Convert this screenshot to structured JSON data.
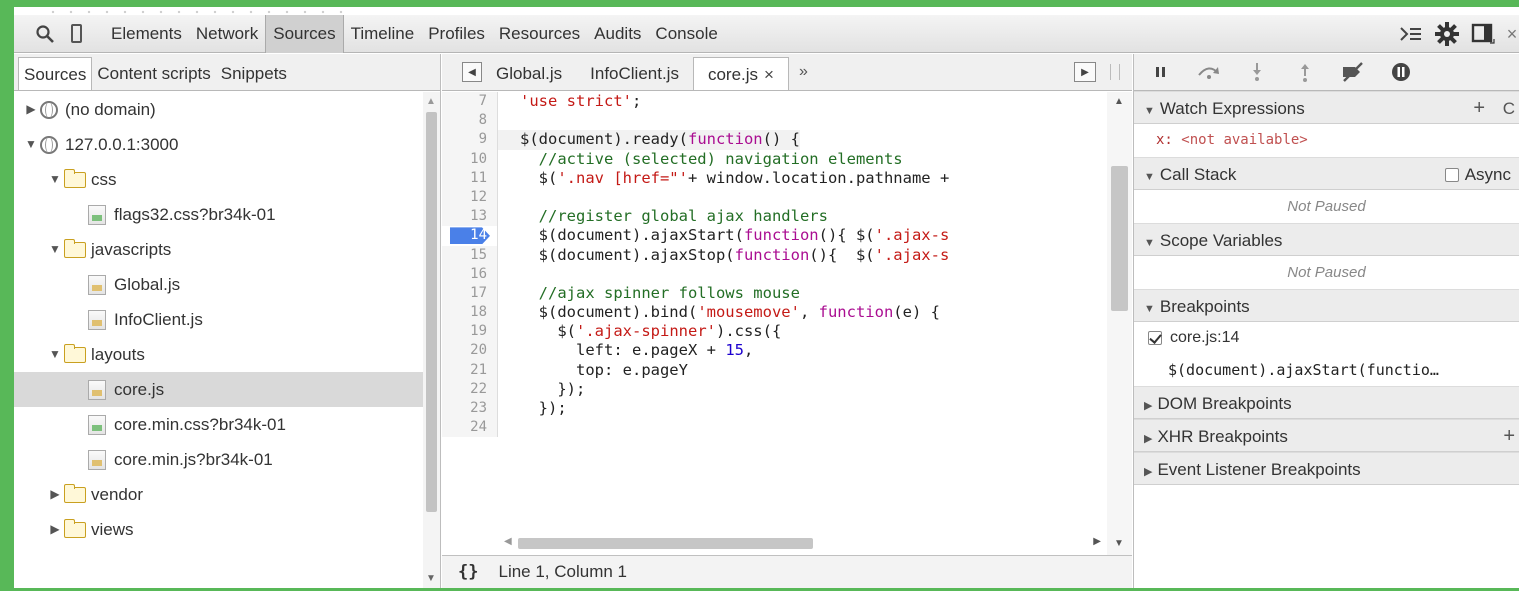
{
  "toolbar": {
    "tabs": [
      "Elements",
      "Network",
      "Sources",
      "Timeline",
      "Profiles",
      "Resources",
      "Audits",
      "Console"
    ],
    "active_tab": "Sources"
  },
  "navigator": {
    "tabs": [
      "Sources",
      "Content scripts",
      "Snippets"
    ],
    "tree": [
      {
        "label": "(no domain)",
        "kind": "domain",
        "depth": 0,
        "expanded": false
      },
      {
        "label": "127.0.0.1:3000",
        "kind": "domain",
        "depth": 0,
        "expanded": true
      },
      {
        "label": "css",
        "kind": "folder",
        "depth": 1,
        "expanded": true
      },
      {
        "label": "flags32.css?br34k-01",
        "kind": "css",
        "depth": 2
      },
      {
        "label": "javascripts",
        "kind": "folder",
        "depth": 1,
        "expanded": true
      },
      {
        "label": "Global.js",
        "kind": "js",
        "depth": 2
      },
      {
        "label": "InfoClient.js",
        "kind": "js",
        "depth": 2
      },
      {
        "label": "layouts",
        "kind": "folder",
        "depth": 1,
        "expanded": true
      },
      {
        "label": "core.js",
        "kind": "js",
        "depth": 2,
        "selected": true
      },
      {
        "label": "core.min.css?br34k-01",
        "kind": "css",
        "depth": 2
      },
      {
        "label": "core.min.js?br34k-01",
        "kind": "js",
        "depth": 2
      },
      {
        "label": "vendor",
        "kind": "folder",
        "depth": 1,
        "expanded": false
      },
      {
        "label": "views",
        "kind": "folder",
        "depth": 1,
        "expanded": false
      }
    ]
  },
  "editor": {
    "tabs": [
      {
        "label": "Global.js",
        "active": false
      },
      {
        "label": "InfoClient.js",
        "active": false
      },
      {
        "label": "core.js",
        "active": true,
        "close": "×"
      }
    ],
    "more": "»",
    "breakpoint_line": "14",
    "lines": [
      {
        "n": "7",
        "html": "<span class=\"str\">'use strict'</span>;"
      },
      {
        "n": "8",
        "html": ""
      },
      {
        "n": "9",
        "html": "$(document).ready(<span class=\"kw\">function</span>() {"
      },
      {
        "n": "10",
        "html": "  <span class=\"cm\">//active (selected) navigation elements</span>"
      },
      {
        "n": "11",
        "html": "  $(<span class=\"str\">'.nav [href=\"'</span>+ window.location.pathname +"
      },
      {
        "n": "12",
        "html": ""
      },
      {
        "n": "13",
        "html": "  <span class=\"cm\">//register global ajax handlers</span>"
      },
      {
        "n": "14",
        "html": "  $(document).ajaxStart(<span class=\"kw\">function</span>(){ $(<span class=\"str\">'.ajax-s</span>"
      },
      {
        "n": "15",
        "html": "  $(document).ajaxStop(<span class=\"kw\">function</span>(){  $(<span class=\"str\">'.ajax-s</span>"
      },
      {
        "n": "16",
        "html": ""
      },
      {
        "n": "17",
        "html": "  <span class=\"cm\">//ajax spinner follows mouse</span>"
      },
      {
        "n": "18",
        "html": "  $(document).bind(<span class=\"str\">'mousemove'</span>, <span class=\"kw\">function</span>(e) {"
      },
      {
        "n": "19",
        "html": "    $(<span class=\"str\">'.ajax-spinner'</span>).css({"
      },
      {
        "n": "20",
        "html": "      left: e.pageX + <span class=\"num\">15</span>,"
      },
      {
        "n": "21",
        "html": "      top: e.pageY"
      },
      {
        "n": "22",
        "html": "    });"
      },
      {
        "n": "23",
        "html": "  });"
      },
      {
        "n": "24",
        "html": ""
      }
    ],
    "status": {
      "braces": "{}",
      "position": "Line 1, Column 1"
    }
  },
  "debugger": {
    "watch": {
      "title": "Watch Expressions",
      "add": "+",
      "refresh": "C",
      "expr": "x:",
      "value": "<not available>"
    },
    "callstack": {
      "title": "Call Stack",
      "async_label": "Async",
      "body": "Not Paused"
    },
    "scope": {
      "title": "Scope Variables",
      "body": "Not Paused"
    },
    "breakpoints": {
      "title": "Breakpoints",
      "item_label": "core.js:14",
      "item_code": "$(document).ajaxStart(functio…"
    },
    "dom": {
      "title": "DOM Breakpoints"
    },
    "xhr": {
      "title": "XHR Breakpoints",
      "add": "+"
    },
    "events": {
      "title": "Event Listener Breakpoints"
    }
  },
  "icons": {
    "search": "search-icon",
    "device": "device-mode-icon",
    "console_drawer": "console-drawer-icon",
    "settings": "gear-icon",
    "dock": "dock-icon",
    "close": "close-icon"
  }
}
